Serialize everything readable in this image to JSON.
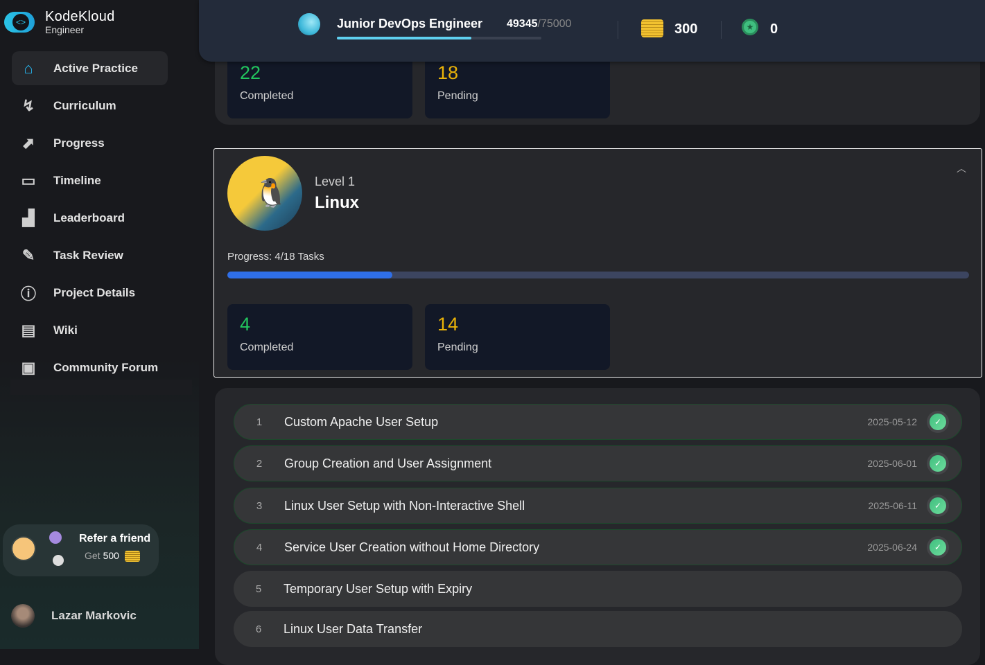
{
  "brand": {
    "name": "KodeKloud",
    "sub": "Engineer"
  },
  "nav": [
    {
      "label": "Active Practice",
      "icon": "home-icon"
    },
    {
      "label": "Curriculum",
      "icon": "route-icon"
    },
    {
      "label": "Progress",
      "icon": "chart-icon"
    },
    {
      "label": "Timeline",
      "icon": "calendar-icon"
    },
    {
      "label": "Leaderboard",
      "icon": "podium-icon"
    },
    {
      "label": "Task Review",
      "icon": "review-icon"
    },
    {
      "label": "Project Details",
      "icon": "info-icon"
    },
    {
      "label": "Wiki",
      "icon": "book-icon"
    },
    {
      "label": "Community Forum",
      "icon": "chat-icon"
    }
  ],
  "refer": {
    "title": "Refer a friend",
    "get": "Get",
    "amount": "500"
  },
  "user": {
    "name": "Lazar Markovic"
  },
  "topbar": {
    "rank": "Junior DevOps Engineer",
    "xp": "49345",
    "xp_total": "/75000",
    "xp_progress": 0.658,
    "coins": "300",
    "badges": "0"
  },
  "prev_card": {
    "completed": "22",
    "completed_label": "Completed",
    "pending": "18",
    "pending_label": "Pending"
  },
  "course": {
    "level": "Level 1",
    "name": "Linux",
    "progress_label": "Progress: 4/18 Tasks",
    "progress": 0.222,
    "completed": "4",
    "completed_label": "Completed",
    "pending": "14",
    "pending_label": "Pending"
  },
  "tasks": [
    {
      "num": "1",
      "title": "Custom Apache User Setup",
      "date": "2025-05-12",
      "done": true
    },
    {
      "num": "2",
      "title": "Group Creation and User Assignment",
      "date": "2025-06-01",
      "done": true
    },
    {
      "num": "3",
      "title": "Linux User Setup with Non-Interactive Shell",
      "date": "2025-06-11",
      "done": true
    },
    {
      "num": "4",
      "title": "Service User Creation without Home Directory",
      "date": "2025-06-24",
      "done": true
    },
    {
      "num": "5",
      "title": "Temporary User Setup with Expiry",
      "date": "",
      "done": false
    },
    {
      "num": "6",
      "title": "Linux User Data Transfer",
      "date": "",
      "done": false
    }
  ]
}
